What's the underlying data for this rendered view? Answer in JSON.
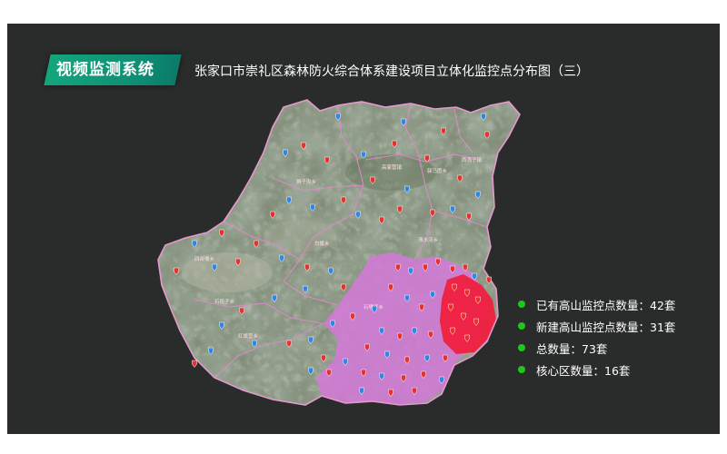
{
  "header": {
    "badge_label": "视频监测系统",
    "map_title": "张家口市崇礼区森林防火综合体系建设项目立体化监控点分布图（三）"
  },
  "colors": {
    "panel_bg": "#2a2b2b",
    "badge_green": "#14a57c",
    "zone_magenta": "#cc6fd0",
    "core_red": "#ee2244",
    "marker_red": "#e8302c",
    "marker_blue": "#2f86e8",
    "boundary": "#e08aca",
    "legend_dot": "#1cc81c"
  },
  "map": {
    "town_labels": [
      "狮子沟乡",
      "高家营镇",
      "西湾子镇",
      "四台嘴乡",
      "白旗乡",
      "驿马图乡",
      "红旗营乡",
      "石窑子乡",
      "清水河乡",
      "石嘴子乡"
    ],
    "marker_legend": {
      "existing_color_name": "blue-marker-icon",
      "new_color_name": "red-marker-icon"
    }
  },
  "stats": [
    {
      "label": "已有高山监控点数量：42套"
    },
    {
      "label": "新建高山监控点数量：31套"
    },
    {
      "label": "总数量：73套"
    },
    {
      "label": "核心区数量：16套"
    }
  ]
}
